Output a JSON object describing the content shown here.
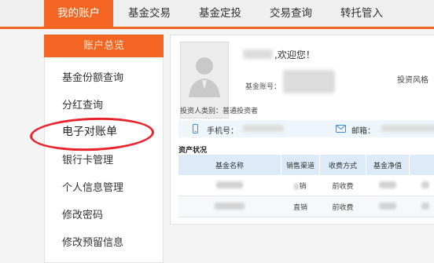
{
  "nav": {
    "tabs": [
      {
        "label": "我的账户",
        "active": true
      },
      {
        "label": "基金交易",
        "active": false
      },
      {
        "label": "基金定投",
        "active": false
      },
      {
        "label": "交易查询",
        "active": false
      },
      {
        "label": "转托管入",
        "active": false
      }
    ]
  },
  "sidebar": {
    "header": "账户总览",
    "items": [
      {
        "label": "基金份额查询"
      },
      {
        "label": "分红查询"
      },
      {
        "label": "电子对账单",
        "highlighted": true
      },
      {
        "label": "银行卡管理"
      },
      {
        "label": "个人信息管理"
      },
      {
        "label": "修改密码"
      },
      {
        "label": "修改预留信息"
      }
    ]
  },
  "profile": {
    "welcome": ",欢迎您！",
    "account_label": "基金账号：",
    "risk_label": "投资风格",
    "investor_type": "投资人类别：普通投资者",
    "phone_label": "手机号：",
    "email_label": "邮箱："
  },
  "assets": {
    "title": "资产状况",
    "columns": [
      "基金名称",
      "销售渠道",
      "收费方式",
      "基金净值"
    ],
    "rows": [
      {
        "channel": "销",
        "fee": "前收费"
      },
      {
        "channel": "直销",
        "fee": "前收费"
      }
    ]
  },
  "colors": {
    "accent": "#f26522",
    "annotation_circle": "#e8242c",
    "table_header": "#dcebf7"
  },
  "icons": [
    "avatar-placeholder-icon",
    "mobile-phone-icon",
    "mail-icon"
  ]
}
